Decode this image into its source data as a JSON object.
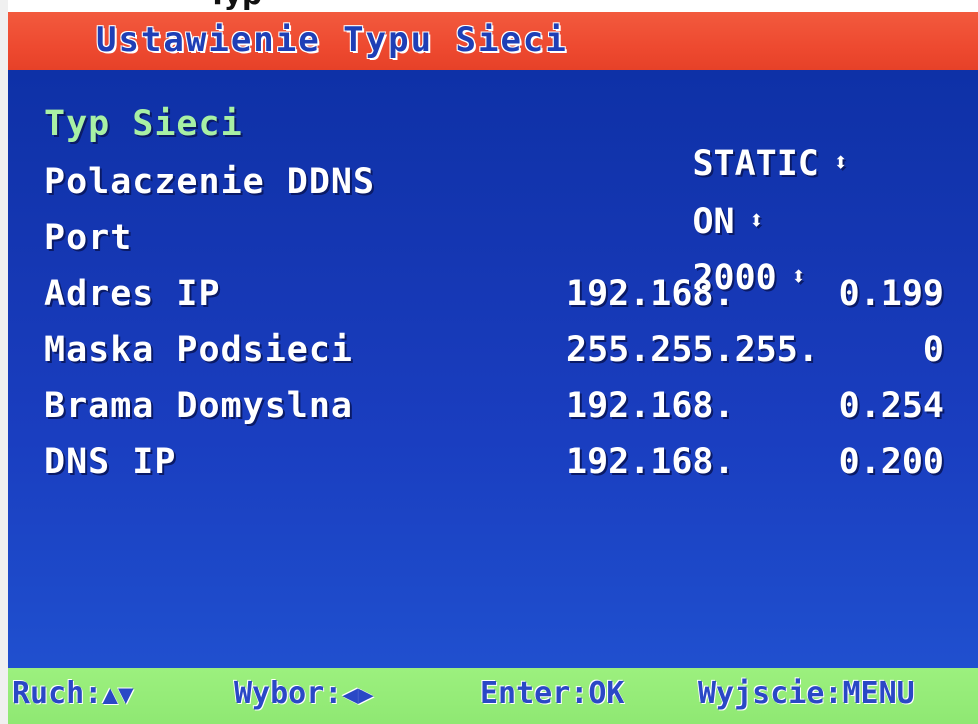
{
  "header_partial": "Typ",
  "title": "Ustawienie Typu Sieci",
  "rows": [
    {
      "label": "Typ Sieci",
      "value": "STATIC",
      "selected": true
    },
    {
      "label": "Polaczenie DDNS",
      "value": "ON",
      "selected": false
    },
    {
      "label": "Port",
      "value": "2000",
      "selected": false
    },
    {
      "label": "Adres IP",
      "value_left": "192.168.",
      "value_right": "0.199"
    },
    {
      "label": "Maska Podsieci",
      "value_left": "255.255.255.",
      "value_right": "0"
    },
    {
      "label": "Brama Domyslna",
      "value_left": "192.168.",
      "value_right": "0.254"
    },
    {
      "label": "DNS IP",
      "value_left": "192.168.",
      "value_right": "0.200"
    }
  ],
  "updown_glyph": "⬍",
  "help": {
    "move_label": "Ruch:",
    "move_glyph": "▲▼",
    "select_label": "Wybor:",
    "select_glyph": "◀▶",
    "enter": "Enter:OK",
    "exit": "Wyjscie:MENU"
  },
  "colors": {
    "title_bar": "#ee4a30",
    "screen": "#1537b3",
    "help_bar": "#9cf07e",
    "selected_label": "#a8f0a4"
  }
}
